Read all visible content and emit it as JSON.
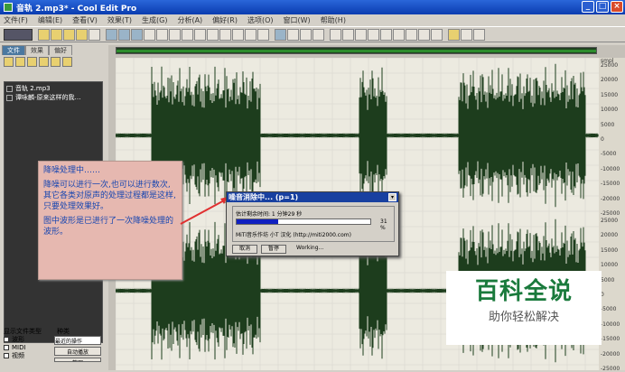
{
  "window": {
    "title": "音轨  2.mp3* - Cool Edit Pro"
  },
  "menu": [
    "文件(F)",
    "编辑(E)",
    "查看(V)",
    "效果(T)",
    "生成(G)",
    "分析(A)",
    "偏好(R)",
    "选项(O)",
    "窗口(W)",
    "帮助(H)"
  ],
  "left_panel": {
    "tabs": [
      "文件",
      "效果",
      "偏好"
    ],
    "files": [
      "音轨  2.mp3",
      "谭咏麟-原来这样的我…"
    ],
    "file_type_label": "显示文件类型",
    "sort_label": "种类",
    "types": [
      "波形",
      "MIDI",
      "视频"
    ],
    "sort_value": "最近的操作",
    "buttons": [
      "自动播放",
      "整理"
    ]
  },
  "ruler": {
    "units": "smpl",
    "ticks": [
      "25000",
      "20000",
      "15000",
      "10000",
      "5000",
      "0",
      "-5000",
      "-10000",
      "-15000",
      "-20000",
      "-25000"
    ]
  },
  "note": {
    "heading": "降噪处理中……",
    "para1": "降噪可以进行一次,也可以进行数次,其它各类对原声的处理过程都是这样,只要处理效果好。",
    "para2": "图中波形是已进行了一次降噪处理的波形。"
  },
  "dialog": {
    "title": "噪音消除中... (p=1)",
    "remaining": "估计剩余时间: 1 分钟29 秒",
    "progress_percent": 31,
    "percent_text": "31 %",
    "credit": "MiTi音乐作坊 小T 汉化 (http://miti2000.com)",
    "btn_cancel": "取消",
    "btn_pause": "暂停",
    "status": "Working..."
  },
  "watermark": {
    "big": "百科全说",
    "small": "助你轻松解决"
  },
  "colors": {
    "title_bar": "#0a3cb0",
    "wave": "#1d3d1d",
    "note_bg": "#e6b8b0",
    "note_text": "#1846b0",
    "progress": "#1020c0",
    "watermark_green": "#1a7a3c"
  }
}
